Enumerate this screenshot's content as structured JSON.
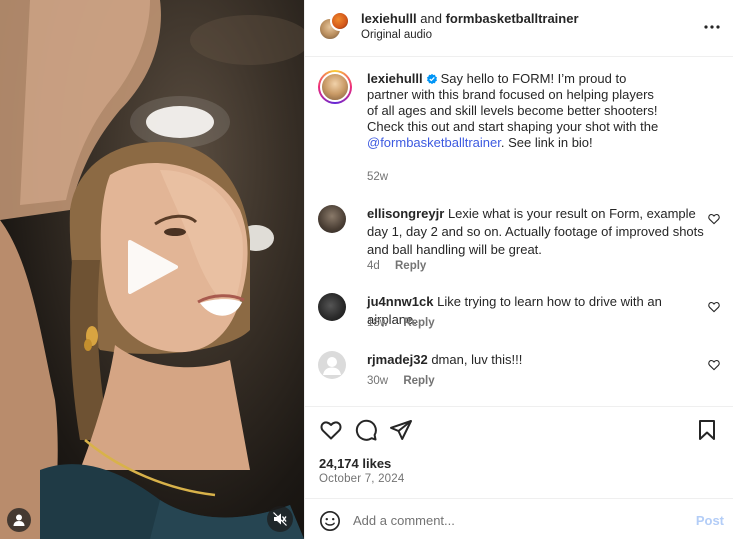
{
  "post": {
    "media": {
      "play_icon": "play-icon",
      "user_icon": "user-icon",
      "mute_icon": "speaker-muted-icon"
    },
    "header": {
      "author": "lexiehulll",
      "joiner": "and",
      "collaborator": "formbasketballtrainer",
      "audio": "Original audio",
      "more_icon": "more-horizontal-icon"
    },
    "caption": {
      "username": "lexiehulll",
      "verified_icon": "verified-badge-icon",
      "text_before": "Say hello to FORM! I’m proud to partner with this brand focused on helping players of all ages and skill levels become better shooters! Check this out and start shaping your shot with the",
      "mention": "@formbasketballtrainer",
      "text_after": ". See link in bio!",
      "time": "52w"
    },
    "comments": [
      {
        "username": "ellisongreyjr",
        "text": "Lexie what is your result on Form, example day 1, day 2 and so on. Actually footage of improved shots and ball handling will be great.",
        "time": "4d",
        "reply": "Reply"
      },
      {
        "username": "ju4nnw1ck",
        "text": "Like trying to learn how to drive with an airplane.",
        "time": "18w",
        "reply": "Reply"
      },
      {
        "username": "rjmadej32",
        "text": "dman, luv this!!!",
        "time": "30w",
        "reply": "Reply"
      }
    ],
    "actions": {
      "like_icon": "heart-icon",
      "comment_icon": "comment-icon",
      "share_icon": "share-icon",
      "save_icon": "bookmark-icon"
    },
    "likes": "24,174 likes",
    "date": "October 7, 2024",
    "composer": {
      "emoji_icon": "emoji-icon",
      "placeholder": "Add a comment...",
      "post_label": "Post"
    },
    "colors": {
      "link": "#3d5ae0",
      "verified": "#0095f6",
      "post_disabled": "#b3cdf7",
      "secondary_text": "#737373"
    }
  }
}
